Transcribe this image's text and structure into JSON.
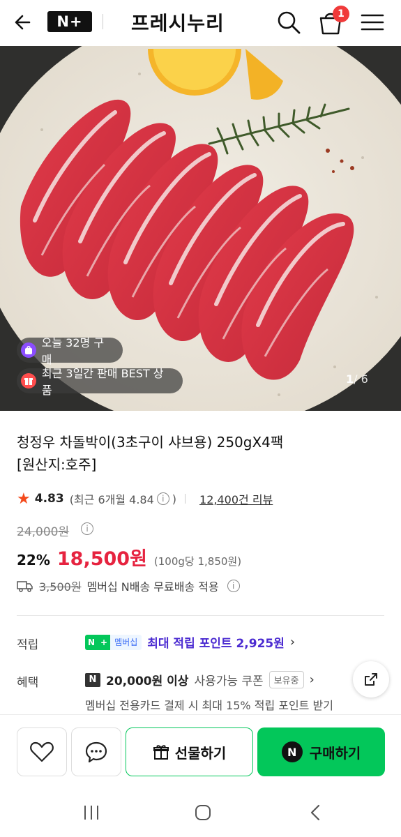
{
  "header": {
    "logo_text": "N+",
    "store_name": "프레시누리",
    "cart_count": "1"
  },
  "hero": {
    "today_badge": "오늘 32명 구매",
    "best_badge": "최근 3일간 판매 BEST 상품",
    "page_current": "1",
    "page_total": "/ 6"
  },
  "product": {
    "title_line1": "청정우 차돌박이(3초구이 샤브용) 250gX4팩",
    "title_line2": "[원산지:호주]",
    "rating": "4.83",
    "rating_recent_prefix": "(최근 6개월 4.84",
    "rating_recent_suffix": ")",
    "review_count": "12,400건 리뷰",
    "original_price": "24,000원",
    "discount": "22%",
    "sale_price": "18,500원",
    "unit_price": "(100g당 1,850원)",
    "shipping_original": "3,500원",
    "shipping_text": "멤버십 N배송 무료배송 적용"
  },
  "benefits": {
    "points_label": "적립",
    "membership_badge_n": "N",
    "membership_badge_plus": "+",
    "membership_badge_text": "멤버십",
    "points_text": "최대 적립 포인트 2,925원",
    "benefit_label": "혜택",
    "coupon_badge": "N",
    "coupon_amount": "20,000원 이상",
    "coupon_desc": "사용가능 쿠폰",
    "coupon_owned": "보유중",
    "card_benefit": "멤버십 전용카드 결제 시 최대 15% 적립 포인트 받기"
  },
  "actions": {
    "gift_label": "선물하기",
    "buy_label": "구매하기",
    "buy_badge": "N"
  },
  "colors": {
    "brand_green": "#03c75a",
    "sale_red": "#e6233f",
    "points_purple": "#4b2bd1",
    "star_orange": "#f44a1c"
  },
  "icons": [
    "back-arrow-icon",
    "search-icon",
    "cart-icon",
    "menu-icon",
    "heart-icon",
    "chat-icon",
    "gift-icon",
    "share-icon",
    "info-icon",
    "truck-icon",
    "star-icon",
    "chevron-right-icon"
  ]
}
